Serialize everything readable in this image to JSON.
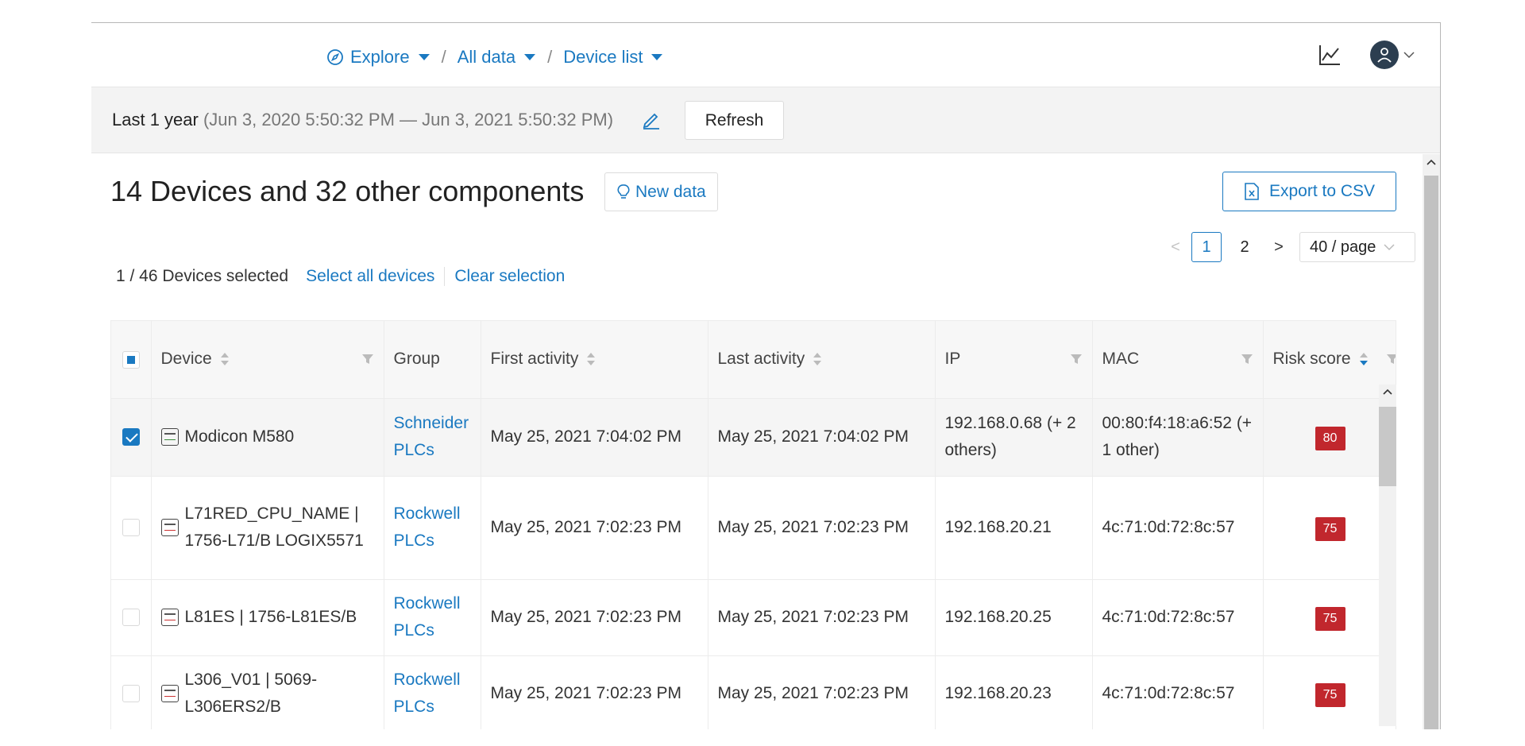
{
  "breadcrumb": {
    "items": [
      {
        "label": "Explore",
        "icon": "compass-icon"
      },
      {
        "label": "All data"
      },
      {
        "label": "Device list"
      }
    ],
    "separator": "/"
  },
  "timebar": {
    "label": "Last 1 year",
    "range": "(Jun 3, 2020 5:50:32 PM — Jun 3, 2021 5:50:32 PM)",
    "refresh_label": "Refresh"
  },
  "main": {
    "title": "14 Devices and 32 other components",
    "new_data_label": "New data",
    "export_label": "Export to CSV"
  },
  "pagination": {
    "pages": [
      "1",
      "2"
    ],
    "current": "1",
    "prev": "<",
    "next": ">",
    "page_size": "40 / page"
  },
  "selection": {
    "count_text": "1 / 46 Devices selected",
    "select_all": "Select all devices",
    "clear": "Clear selection"
  },
  "table": {
    "columns": [
      "Device",
      "Group",
      "First activity",
      "Last activity",
      "IP",
      "MAC",
      "Risk score"
    ],
    "rows": [
      {
        "selected": true,
        "device": "Modicon M580",
        "group": "Schneider PLCs",
        "first": "May 25, 2021 7:04:02 PM",
        "last": "May 25, 2021 7:04:02 PM",
        "ip": "192.168.0.68 (+ 2 others)",
        "mac": "00:80:f4:18:a6:52 (+ 1 other)",
        "risk": "80"
      },
      {
        "selected": false,
        "device": "L71RED_CPU_NAME | 1756-L71/B LOGIX5571",
        "group": "Rockwell PLCs",
        "first": "May 25, 2021 7:02:23 PM",
        "last": "May 25, 2021 7:02:23 PM",
        "ip": "192.168.20.21",
        "mac": "4c:71:0d:72:8c:57",
        "risk": "75"
      },
      {
        "selected": false,
        "device": "L81ES | 1756-L81ES/B",
        "group": "Rockwell PLCs",
        "first": "May 25, 2021 7:02:23 PM",
        "last": "May 25, 2021 7:02:23 PM",
        "ip": "192.168.20.25",
        "mac": "4c:71:0d:72:8c:57",
        "risk": "75"
      },
      {
        "selected": false,
        "device": "L306_V01 | 5069-L306ERS2/B",
        "group": "Rockwell PLCs",
        "first": "May 25, 2021 7:02:23 PM",
        "last": "May 25, 2021 7:02:23 PM",
        "ip": "192.168.20.23",
        "mac": "4c:71:0d:72:8c:57",
        "risk": "75"
      }
    ]
  },
  "colors": {
    "accent": "#1a79c1",
    "risk_badge": "#c1272d"
  }
}
